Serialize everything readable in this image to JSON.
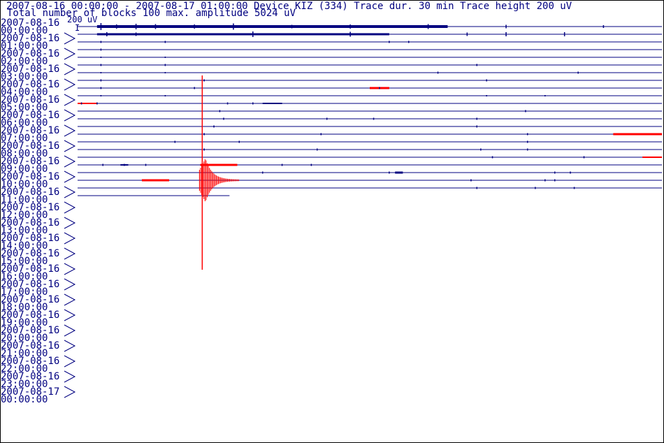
{
  "header": {
    "line1": "2007-08-16 00:00:00 - 2007-08-17 01:00:00  Device  KIZ (334)  Trace dur. 30 min  Trace height 200 uV",
    "line2": "Total number of blocks 100 max. amplitude 5024 uV",
    "scale_label": "200 uV"
  },
  "colors": {
    "trace": "#000080",
    "event": "#ff0000",
    "text": "#000080"
  },
  "chart_data": {
    "type": "helicorder",
    "title": "2007-08-16 00:00:00 - 2007-08-17 01:00:00  Device  KIZ (334)  Trace dur. 30 min  Trace height 200 uV",
    "subtitle": "Total number of blocks 100 max. amplitude 5024 uV",
    "device": "KIZ (334)",
    "trace_duration_min": 30,
    "trace_height_uV": 200,
    "total_blocks": 100,
    "max_amplitude_uV": 5024,
    "hour_labels": [
      {
        "date": "2007-08-16",
        "time": "00:00:00"
      },
      {
        "date": "2007-08-16",
        "time": "01:00:00"
      },
      {
        "date": "2007-08-16",
        "time": "02:00:00"
      },
      {
        "date": "2007-08-16",
        "time": "03:00:00"
      },
      {
        "date": "2007-08-16",
        "time": "04:00:00"
      },
      {
        "date": "2007-08-16",
        "time": "05:00:00"
      },
      {
        "date": "2007-08-16",
        "time": "06:00:00"
      },
      {
        "date": "2007-08-16",
        "time": "07:00:00"
      },
      {
        "date": "2007-08-16",
        "time": "08:00:00"
      },
      {
        "date": "2007-08-16",
        "time": "09:00:00"
      },
      {
        "date": "2007-08-16",
        "time": "10:00:00"
      },
      {
        "date": "2007-08-16",
        "time": "11:00:00"
      },
      {
        "date": "2007-08-16",
        "time": "12:00:00"
      },
      {
        "date": "2007-08-16",
        "time": "13:00:00"
      },
      {
        "date": "2007-08-16",
        "time": "14:00:00"
      },
      {
        "date": "2007-08-16",
        "time": "15:00:00"
      },
      {
        "date": "2007-08-16",
        "time": "16:00:00"
      },
      {
        "date": "2007-08-16",
        "time": "17:00:00"
      },
      {
        "date": "2007-08-16",
        "time": "18:00:00"
      },
      {
        "date": "2007-08-16",
        "time": "19:00:00"
      },
      {
        "date": "2007-08-16",
        "time": "20:00:00"
      },
      {
        "date": "2007-08-16",
        "time": "21:00:00"
      },
      {
        "date": "2007-08-16",
        "time": "22:00:00"
      },
      {
        "date": "2007-08-16",
        "time": "23:00:00"
      },
      {
        "date": "2007-08-17",
        "time": "00:00:00"
      }
    ],
    "traces": [
      {
        "hour": 0,
        "half": 0,
        "end_min": 30,
        "spikes": [
          [
            1.2,
            10
          ],
          [
            2,
            6
          ],
          [
            3,
            8
          ],
          [
            4,
            7
          ],
          [
            6,
            6
          ],
          [
            8,
            9
          ],
          [
            11,
            5
          ],
          [
            14,
            6
          ],
          [
            18,
            7
          ],
          [
            22,
            5
          ],
          [
            27,
            4
          ]
        ],
        "segments": [
          {
            "start": 1,
            "end": 19,
            "amp": 4,
            "color": "trace"
          }
        ]
      },
      {
        "hour": 0,
        "half": 1,
        "end_min": 30,
        "spikes": [
          [
            1.5,
            6
          ],
          [
            3,
            5
          ],
          [
            9,
            8
          ],
          [
            14,
            7
          ],
          [
            20,
            5
          ],
          [
            22,
            6
          ],
          [
            25,
            6
          ]
        ],
        "segments": [
          {
            "start": 1,
            "end": 16,
            "amp": 3,
            "color": "trace"
          }
        ]
      },
      {
        "hour": 1,
        "half": 0,
        "end_min": 30,
        "spikes": [
          [
            1.2,
            3
          ],
          [
            4.5,
            3
          ],
          [
            16,
            3
          ],
          [
            17,
            3
          ]
        ],
        "segments": []
      },
      {
        "hour": 1,
        "half": 1,
        "end_min": 30,
        "spikes": [
          [
            1.2,
            3
          ]
        ],
        "segments": []
      },
      {
        "hour": 2,
        "half": 0,
        "end_min": 30,
        "spikes": [
          [
            1.2,
            2
          ],
          [
            4.5,
            2
          ]
        ],
        "segments": []
      },
      {
        "hour": 2,
        "half": 1,
        "end_min": 30,
        "spikes": [
          [
            1.2,
            3
          ],
          [
            4.5,
            3
          ],
          [
            20.5,
            3
          ]
        ],
        "segments": []
      },
      {
        "hour": 3,
        "half": 0,
        "end_min": 30,
        "spikes": [
          [
            1.2,
            2
          ],
          [
            4.5,
            2
          ],
          [
            18.5,
            3
          ],
          [
            25.7,
            3
          ]
        ],
        "segments": []
      },
      {
        "hour": 3,
        "half": 1,
        "end_min": 30,
        "spikes": [
          [
            1.2,
            3
          ],
          [
            6.5,
            3
          ],
          [
            21,
            3
          ]
        ],
        "segments": []
      },
      {
        "hour": 4,
        "half": 0,
        "end_min": 30,
        "spikes": [
          [
            1.2,
            3
          ],
          [
            6,
            3
          ],
          [
            15.5,
            3
          ]
        ],
        "segments": [
          {
            "start": 15,
            "end": 16,
            "amp": 3,
            "color": "event"
          }
        ]
      },
      {
        "hour": 4,
        "half": 1,
        "end_min": 30,
        "spikes": [
          [
            1.2,
            2
          ],
          [
            4.5,
            2
          ],
          [
            21,
            2
          ],
          [
            24,
            2
          ]
        ],
        "segments": []
      },
      {
        "hour": 5,
        "half": 0,
        "end_min": 30,
        "spikes": [
          [
            0.2,
            3
          ],
          [
            1,
            3
          ],
          [
            7.7,
            3
          ],
          [
            9,
            3
          ]
        ],
        "segments": [
          {
            "start": 0,
            "end": 1,
            "amp": 2,
            "color": "event"
          },
          {
            "start": 9.5,
            "end": 10.5,
            "amp": 2,
            "color": "trace"
          }
        ]
      },
      {
        "hour": 5,
        "half": 1,
        "end_min": 30,
        "spikes": [
          [
            7.3,
            3
          ],
          [
            23,
            3
          ]
        ],
        "segments": []
      },
      {
        "hour": 6,
        "half": 0,
        "end_min": 30,
        "spikes": [
          [
            7.5,
            3
          ],
          [
            12.8,
            3
          ],
          [
            15.2,
            3
          ],
          [
            20.5,
            3
          ]
        ],
        "segments": []
      },
      {
        "hour": 6,
        "half": 1,
        "end_min": 30,
        "spikes": [
          [
            7,
            3
          ],
          [
            20.5,
            3
          ]
        ],
        "segments": []
      },
      {
        "hour": 7,
        "half": 0,
        "end_min": 30,
        "spikes": [
          [
            6.5,
            3
          ],
          [
            12.5,
            3
          ],
          [
            23.1,
            3
          ]
        ],
        "segments": [
          {
            "start": 27.5,
            "end": 30,
            "amp": 3,
            "color": "event"
          }
        ]
      },
      {
        "hour": 7,
        "half": 1,
        "end_min": 30,
        "spikes": [
          [
            5,
            3
          ],
          [
            8.3,
            3
          ],
          [
            23.1,
            3
          ]
        ],
        "segments": []
      },
      {
        "hour": 8,
        "half": 0,
        "end_min": 30,
        "spikes": [
          [
            6.5,
            3
          ],
          [
            12.3,
            3
          ],
          [
            20.7,
            3
          ],
          [
            23.1,
            3
          ]
        ],
        "segments": []
      },
      {
        "hour": 8,
        "half": 1,
        "end_min": 30,
        "spikes": [
          [
            21.3,
            3
          ],
          [
            26,
            3
          ]
        ],
        "segments": [
          {
            "start": 29,
            "end": 30,
            "amp": 2,
            "color": "event"
          }
        ]
      },
      {
        "hour": 9,
        "half": 0,
        "end_min": 30,
        "spikes": [
          [
            1.3,
            3
          ],
          [
            2.4,
            3
          ],
          [
            3.5,
            3
          ],
          [
            10.5,
            3
          ],
          [
            12,
            3
          ]
        ],
        "segments": [
          {
            "start": 6.3,
            "end": 8.2,
            "amp": 3,
            "color": "event"
          },
          {
            "start": 2.2,
            "end": 2.6,
            "amp": 2,
            "color": "trace"
          }
        ]
      },
      {
        "hour": 9,
        "half": 1,
        "end_min": 30,
        "spikes": [
          [
            9.5,
            3
          ],
          [
            16,
            3
          ],
          [
            24.5,
            3
          ],
          [
            25.3,
            3
          ]
        ],
        "segments": [
          {
            "start": 16.3,
            "end": 16.7,
            "amp": 3,
            "color": "trace"
          }
        ]
      },
      {
        "hour": 10,
        "half": 0,
        "end_min": 30,
        "spikes": [
          [
            20.2,
            3
          ],
          [
            24,
            3
          ],
          [
            24.5,
            3
          ]
        ],
        "segments": [
          {
            "start": 3.3,
            "end": 4.7,
            "amp": 3,
            "color": "event"
          }
        ]
      },
      {
        "hour": 10,
        "half": 1,
        "end_min": 30,
        "spikes": [
          [
            20.5,
            3
          ],
          [
            23.5,
            3
          ],
          [
            25.5,
            3
          ]
        ],
        "segments": []
      },
      {
        "hour": 11,
        "half": 0,
        "end_min": 7.8,
        "spikes": [],
        "segments": []
      }
    ],
    "event": {
      "hour": 10,
      "half": 0,
      "minute": 6.4,
      "up_px": 150,
      "down_px": 128
    }
  }
}
